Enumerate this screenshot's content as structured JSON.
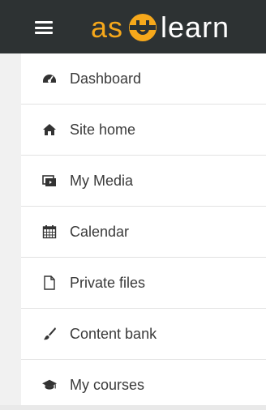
{
  "header": {
    "logo_part1": "as",
    "logo_part2": "learn",
    "accent_color": "#f6a81b",
    "background_color": "#2d3233"
  },
  "menu": {
    "items": [
      {
        "label": "Dashboard",
        "icon": "dashboard-icon"
      },
      {
        "label": "Site home",
        "icon": "home-icon"
      },
      {
        "label": "My Media",
        "icon": "media-icon"
      },
      {
        "label": "Calendar",
        "icon": "calendar-icon"
      },
      {
        "label": "Private files",
        "icon": "file-icon"
      },
      {
        "label": "Content bank",
        "icon": "brush-icon"
      },
      {
        "label": "My courses",
        "icon": "graduation-cap-icon"
      }
    ]
  }
}
